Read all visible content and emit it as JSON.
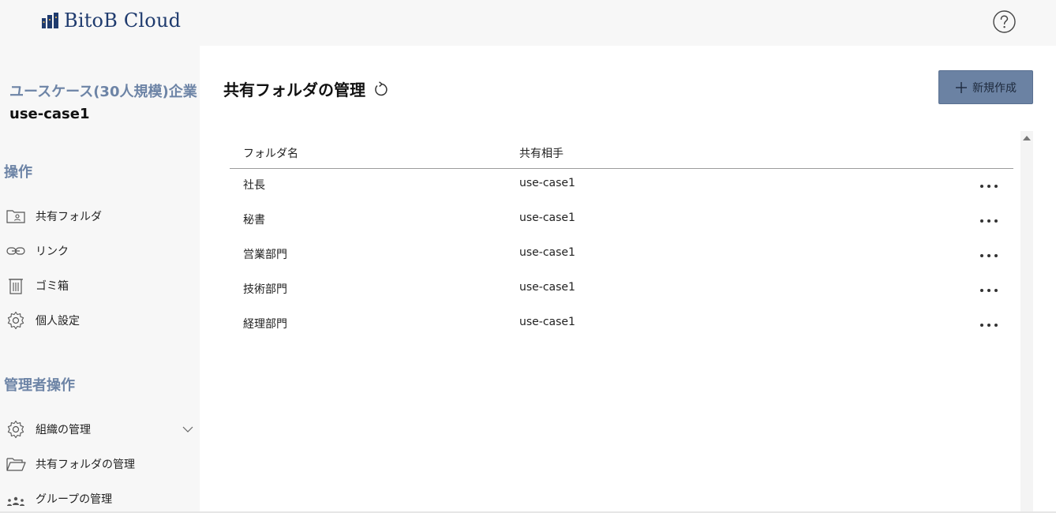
{
  "header": {
    "logo_text": "BitoB Cloud",
    "logo_icon": "building-bars-icon",
    "help_icon": "help-circle-icon"
  },
  "sidebar": {
    "org_name": "ユースケース(30人規模)企業",
    "org_id": "use-case1",
    "operations_title": "操作",
    "operations": [
      {
        "label": "共有フォルダ",
        "icon": "shared-folder-icon"
      },
      {
        "label": "リンク",
        "icon": "link-icon"
      },
      {
        "label": "ゴミ箱",
        "icon": "trash-icon"
      },
      {
        "label": "個人設定",
        "icon": "gear-icon"
      }
    ],
    "admin_title": "管理者操作",
    "admin": [
      {
        "label": "組織の管理",
        "icon": "gear-icon",
        "expandable": true
      },
      {
        "label": "共有フォルダの管理",
        "icon": "open-folder-icon"
      },
      {
        "label": "グループの管理",
        "icon": "group-icon"
      }
    ]
  },
  "main": {
    "title": "共有フォルダの管理",
    "new_button_label": "新規作成",
    "columns": [
      "フォルダ名",
      "共有相手"
    ],
    "rows": [
      {
        "folder": "社長",
        "shared_with": "use-case1"
      },
      {
        "folder": "秘書",
        "shared_with": "use-case1"
      },
      {
        "folder": "営業部門",
        "shared_with": "use-case1"
      },
      {
        "folder": "技術部門",
        "shared_with": "use-case1"
      },
      {
        "folder": "経理部門",
        "shared_with": "use-case1"
      }
    ]
  },
  "colors": {
    "accent": "#6b82a3",
    "section_title": "#6d84a6",
    "logo": "#1f3b6e",
    "sidebar_bg": "#f7f7f7",
    "main_bg": "#ffffff"
  }
}
